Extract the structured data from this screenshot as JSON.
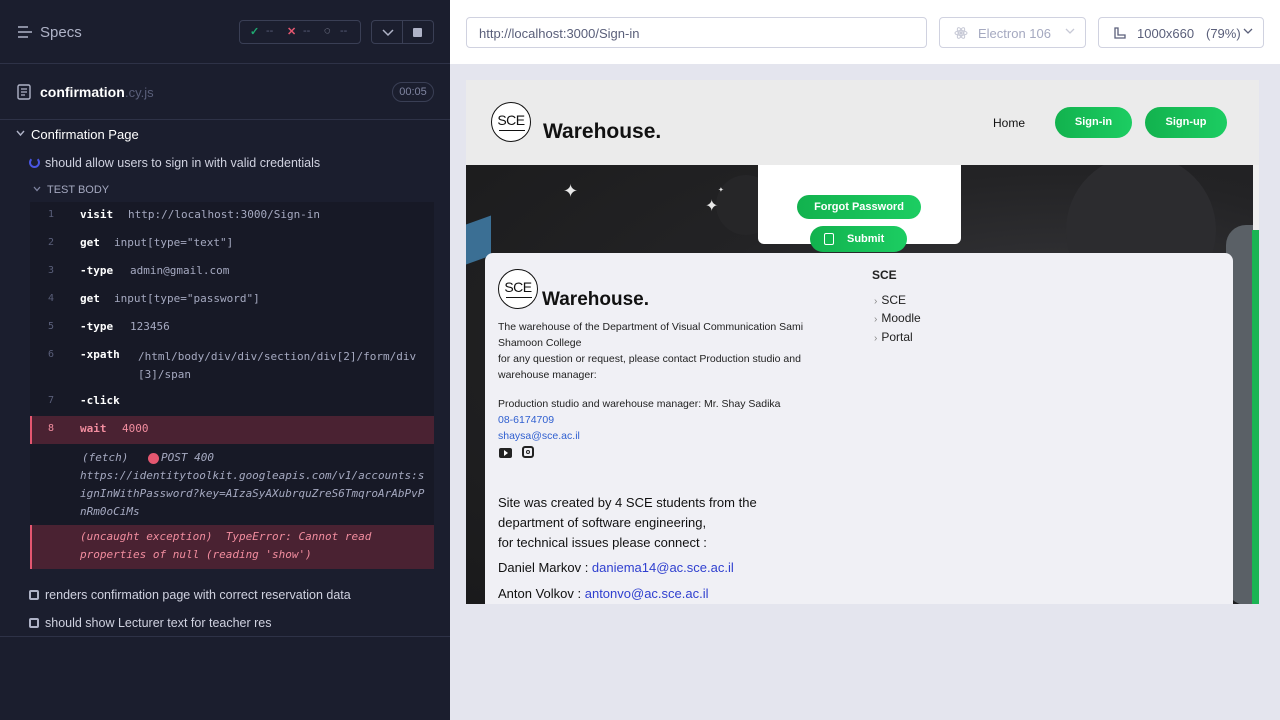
{
  "runner": {
    "specs_label": "Specs",
    "stats": {
      "passed": "--",
      "failed": "--",
      "pending": "--"
    },
    "file": {
      "name": "confirmation",
      "ext": ".cy.js",
      "duration": "00:05"
    },
    "suite_title": "Confirmation Page",
    "active_test": "should allow users to sign in with valid credentials",
    "test_body_label": "TEST BODY",
    "commands": [
      {
        "num": "1",
        "name": "visit",
        "arg": "http://localhost:3000/Sign-in"
      },
      {
        "num": "2",
        "name": "get",
        "arg": "input[type=\"text\"]"
      },
      {
        "num": "3",
        "name": "-type",
        "arg": "admin@gmail.com"
      },
      {
        "num": "4",
        "name": "get",
        "arg": "input[type=\"password\"]"
      },
      {
        "num": "5",
        "name": "-type",
        "arg": "123456"
      },
      {
        "num": "6",
        "name": "-xpath",
        "arg": "/html/body/div/div/section/div[2]/form/div[3]/span"
      },
      {
        "num": "7",
        "name": "-click",
        "arg": ""
      },
      {
        "num": "8",
        "name": "wait",
        "arg": "4000"
      }
    ],
    "fetch": {
      "label": "(fetch)",
      "status": "POST 400",
      "url": "https://identitytoolkit.googleapis.com/v1/accounts:signInWithPassword?key=AIzaSyAXubrquZreS6TmqroArAbPvPnRm0oCiMs"
    },
    "exception": {
      "label": "(uncaught exception)",
      "message": "TypeError: Cannot read properties of null (reading 'show')"
    },
    "pending_tests": [
      "renders confirmation page with correct reservation data",
      "should show Lecturer text for teacher res"
    ]
  },
  "browser": {
    "url": "http://localhost:3000/Sign-in",
    "name": "Electron 106",
    "viewport": "1000x660",
    "zoom": "(79%)"
  },
  "app": {
    "logo_text": "SCE",
    "brand": "Warehouse.",
    "nav": {
      "home": "Home",
      "signin": "Sign-in",
      "signup": "Sign-up"
    },
    "forgot_password": "Forgot Password",
    "submit": "Submit",
    "footer": {
      "description": "The warehouse of the Department of Visual Communication Sami Shamoon College\nfor any question or request, please contact Production studio and warehouse manager:",
      "manager": "Production studio and warehouse manager: Mr. Shay Sadika",
      "phone": "08-6174709",
      "email": "shaysa@sce.ac.il",
      "credit": "Site was created by 4 SCE students from the department of software engineering,\nfor technical issues please connect :",
      "people": [
        {
          "name": "Daniel Markov : ",
          "email": "daniema14@ac.sce.ac.il"
        },
        {
          "name": "Anton Volkov : ",
          "email": "antonvo@ac.sce.ac.il"
        }
      ],
      "links_title": "SCE",
      "links": [
        "SCE",
        "Moodle",
        "Portal"
      ]
    }
  },
  "colors": {
    "runner_bg": "#1b1e2e",
    "accent_green": "#1ccd62",
    "fail_red": "#e45770",
    "link_blue": "#2f5fd0"
  }
}
